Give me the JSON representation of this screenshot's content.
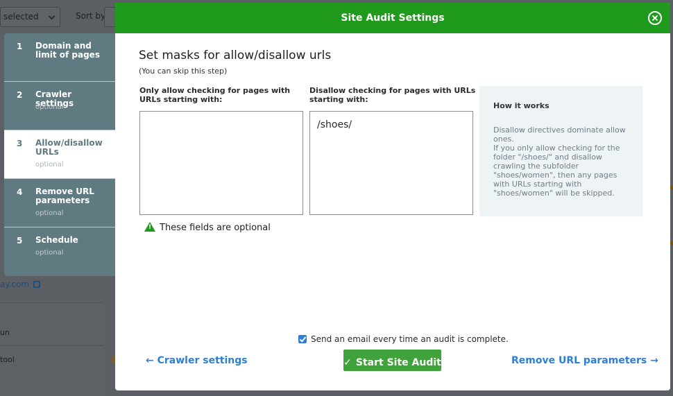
{
  "background": {
    "select_label": "selected",
    "sort_label": "Sort by",
    "domain_link": "ay.com",
    "row_run": "un",
    "row_tool": "tool"
  },
  "steps": [
    {
      "number": "1",
      "title": "Domain and limit of pages",
      "optional": ""
    },
    {
      "number": "2",
      "title": "Crawler settings",
      "optional": "optional"
    },
    {
      "number": "3",
      "title": "Allow/disallow URLs",
      "optional": "optional"
    },
    {
      "number": "4",
      "title": "Remove URL parameters",
      "optional": "optional"
    },
    {
      "number": "5",
      "title": "Schedule",
      "optional": "optional"
    }
  ],
  "modal": {
    "title": "Site Audit Settings",
    "heading": "Set masks for allow/disallow urls",
    "subheading": "(You can skip this step)",
    "allow_label": "Only allow checking for pages with URLs starting with:",
    "allow_value": "",
    "disallow_label": "Disallow checking for pages with URLs starting with:",
    "disallow_value": "/shoes/",
    "optional_note": "These fields are optional",
    "how_title": "How it works",
    "how_text": "Disallow directives dominate allow ones.\nIf you only allow checking for the folder \"/shoes/\" and disallow crawling the subfolder \"shoes/women\", then any pages with URLs starting with \"shoes/women\" will be skipped.",
    "email_label": "Send an email every time an audit is complete.",
    "prev_label": "Crawler settings",
    "start_label": "Start Site Audit",
    "next_label": "Remove URL parameters"
  },
  "colors": {
    "header_green": "#1f9a1c",
    "button_green": "#3fa23a",
    "link_blue": "#2d7fd6",
    "sidebar": "#5f7a80"
  }
}
